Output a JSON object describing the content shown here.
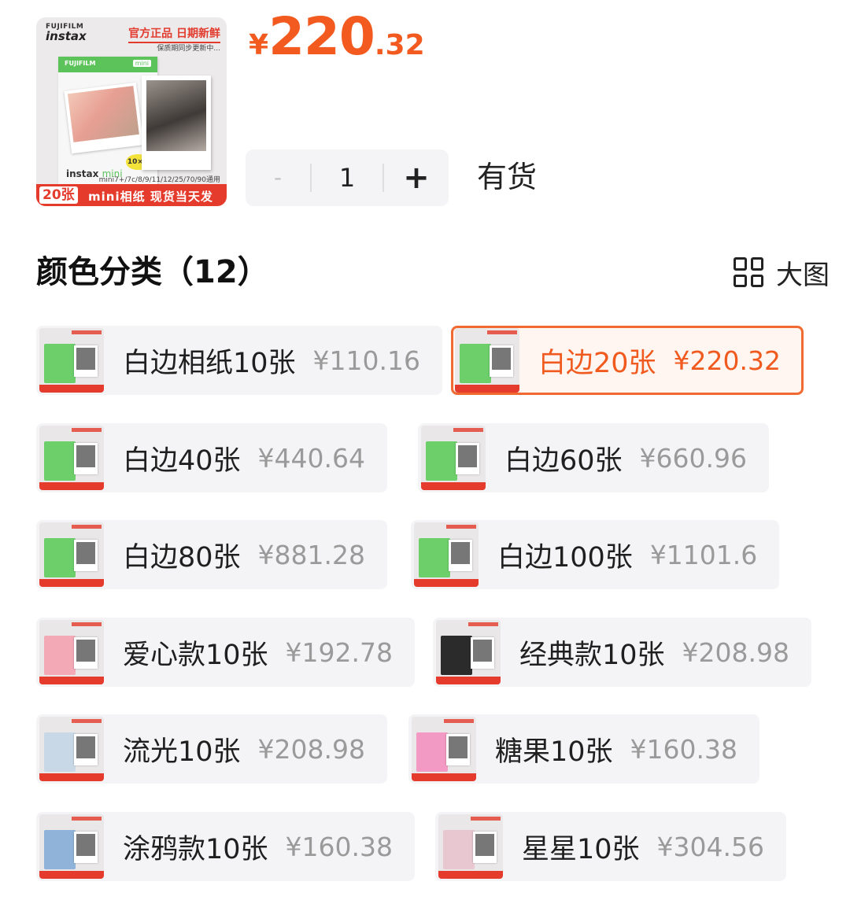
{
  "product": {
    "brand_line1": "FUJIFILM",
    "brand_line2": "instax",
    "badge": "官方正品 日期新鲜",
    "badge_sub": "保质期同步更新中...",
    "box_band": "FUJIFILM",
    "box_band_tag": "mini",
    "box_label": "instax",
    "box_label_mini": "mini",
    "box_count": "10×2",
    "compat": "mini7+/7c/8/9/11/12/25/70/90通用",
    "bar_count": "20张",
    "bar_text": "mini相纸 现货当天发"
  },
  "price": {
    "symbol": "¥",
    "integer": "220",
    "decimal": ".32",
    "color": "#f25a1f"
  },
  "stepper": {
    "minus": "-",
    "quantity": "1",
    "plus": "+"
  },
  "stock_status": "有货",
  "section": {
    "title": "颜色分类（12）",
    "view_toggle": "大图"
  },
  "skus": [
    {
      "name": "白边相纸10张",
      "price": "¥110.16",
      "selected": false,
      "thumb_color": "#6ccf6a"
    },
    {
      "name": "白边20张",
      "price": "¥220.32",
      "selected": true,
      "thumb_color": "#6ccf6a"
    },
    {
      "name": "白边40张",
      "price": "¥440.64",
      "selected": false,
      "thumb_color": "#6ccf6a"
    },
    {
      "name": "白边60张",
      "price": "¥660.96",
      "selected": false,
      "thumb_color": "#6ccf6a"
    },
    {
      "name": "白边80张",
      "price": "¥881.28",
      "selected": false,
      "thumb_color": "#6ccf6a"
    },
    {
      "name": "白边100张",
      "price": "¥1101.6",
      "selected": false,
      "thumb_color": "#6ccf6a"
    },
    {
      "name": "爱心款10张",
      "price": "¥192.78",
      "selected": false,
      "thumb_color": "#f3a9b6"
    },
    {
      "name": "经典款10张",
      "price": "¥208.98",
      "selected": false,
      "thumb_color": "#2b2b2b"
    },
    {
      "name": "流光10张",
      "price": "¥208.98",
      "selected": false,
      "thumb_color": "#c9d8e6"
    },
    {
      "name": "糖果10张",
      "price": "¥160.38",
      "selected": false,
      "thumb_color": "#f29ac3"
    },
    {
      "name": "涂鸦款10张",
      "price": "¥160.38",
      "selected": false,
      "thumb_color": "#8fb3d9"
    },
    {
      "name": "星星10张",
      "price": "¥304.56",
      "selected": false,
      "thumb_color": "#e8c7d0"
    }
  ]
}
